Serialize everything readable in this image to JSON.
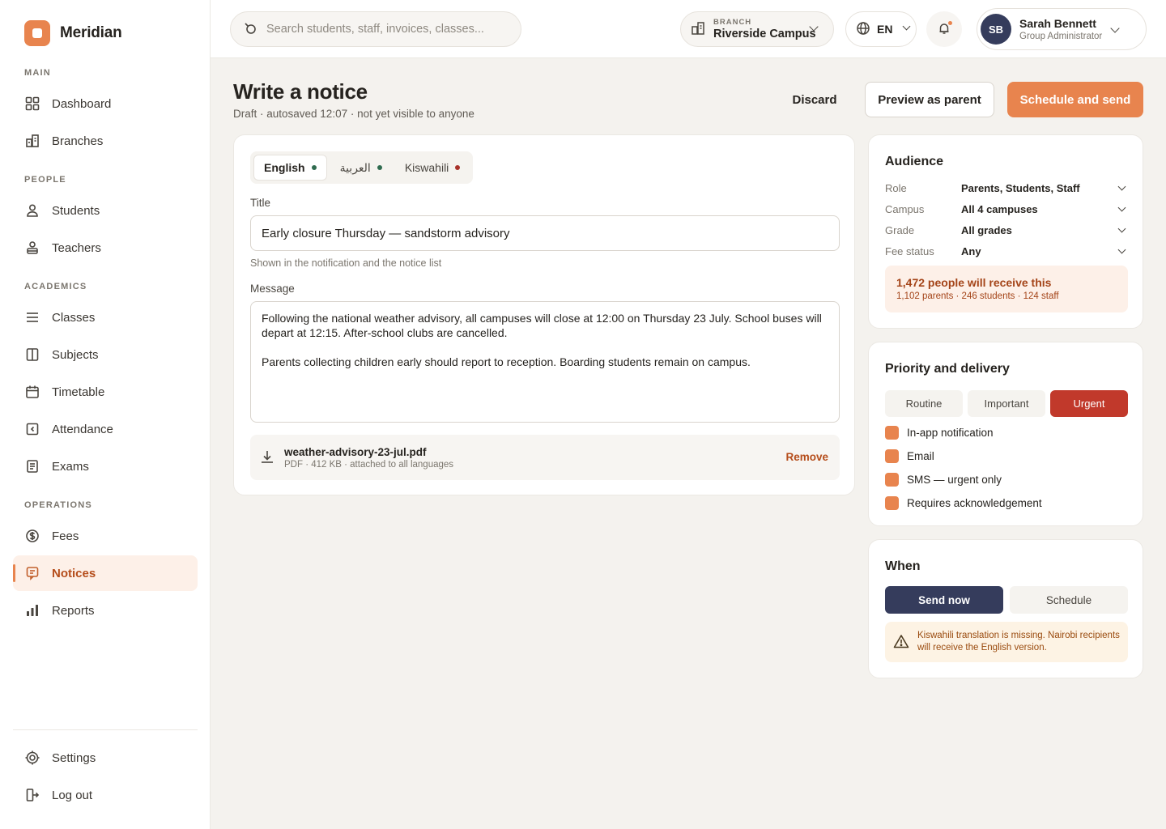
{
  "brand": {
    "name": "Meridian"
  },
  "nav": {
    "main_label": "MAIN",
    "dashboard": "Dashboard",
    "branches": "Branches",
    "people_label": "PEOPLE",
    "students": "Students",
    "teachers": "Teachers",
    "academics_label": "ACADEMICS",
    "classes": "Classes",
    "subjects": "Subjects",
    "timetable": "Timetable",
    "attendance": "Attendance",
    "exams": "Exams",
    "operations_label": "OPERATIONS",
    "fees": "Fees",
    "notices": "Notices",
    "reports": "Reports",
    "settings": "Settings",
    "logout": "Log out"
  },
  "topbar": {
    "search_placeholder": "Search students, staff, invoices, classes...",
    "branch_label": "BRANCH",
    "branch_value": "Riverside Campus",
    "language": "EN",
    "user_initials": "SB",
    "user_name": "Sarah Bennett",
    "user_role": "Group Administrator"
  },
  "page": {
    "title": "Write a notice",
    "subtitle": "Draft · autosaved 12:07 · not yet visible to anyone",
    "discard": "Discard",
    "preview": "Preview as parent",
    "send": "Schedule and send"
  },
  "editor": {
    "languages": [
      {
        "label": "English",
        "status_color": "#2f6b4f"
      },
      {
        "label": "العربية",
        "status_color": "#2f6b4f"
      },
      {
        "label": "Kiswahili",
        "status_color": "#a8322a"
      }
    ],
    "title_label": "Title",
    "title_value": "Early closure Thursday — sandstorm advisory",
    "title_hint": "Shown in the notification and the notice list",
    "message_label": "Message",
    "message_p1": "Following the national weather advisory, all campuses will close at 12:00 on Thursday 23 July. School buses will depart at 12:15. After-school clubs are cancelled.",
    "message_p2": "Parents collecting children early should report to reception. Boarding students remain on campus.",
    "attachment_name": "weather-advisory-23-jul.pdf",
    "attachment_meta": "PDF · 412 KB · attached to all languages",
    "attachment_remove": "Remove"
  },
  "audience": {
    "heading": "Audience",
    "rows": [
      {
        "key": "Role",
        "value": "Parents, Students, Staff"
      },
      {
        "key": "Campus",
        "value": "All 4 campuses"
      },
      {
        "key": "Grade",
        "value": "All grades"
      },
      {
        "key": "Fee status",
        "value": "Any"
      }
    ],
    "reach_title": "1,472 people will receive this",
    "reach_detail": "1,102 parents · 246 students · 124 staff"
  },
  "priority": {
    "heading": "Priority and delivery",
    "options": [
      "Routine",
      "Important",
      "Urgent"
    ],
    "selected": "Urgent",
    "channels": [
      "In-app notification",
      "Email",
      "SMS — urgent only",
      "Requires acknowledgement"
    ]
  },
  "when": {
    "heading": "When",
    "send_now": "Send now",
    "schedule": "Schedule",
    "warning": "Kiswahili translation is missing. Nairobi recipients will receive the English version."
  }
}
